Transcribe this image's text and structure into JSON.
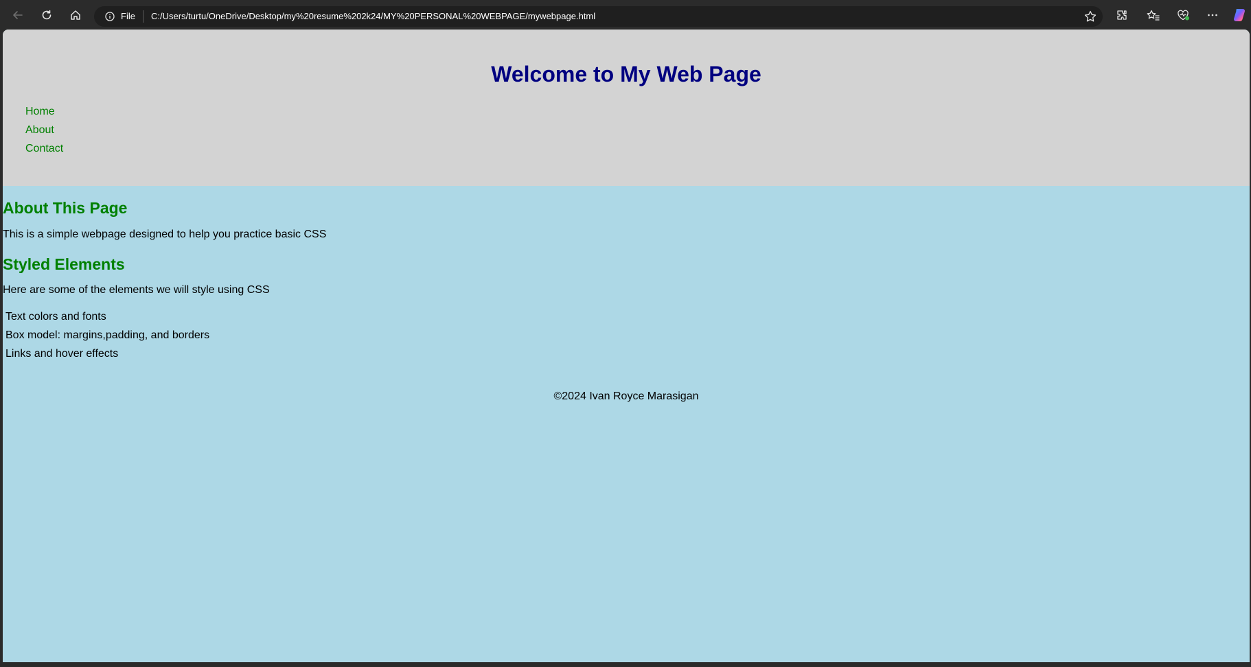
{
  "browser": {
    "address_scheme_label": "File",
    "url": "C:/Users/turtu/OneDrive/Desktop/my%20resume%202k24/MY%20PERSONAL%20WEBPAGE/mywebpage.html",
    "toolbar_icons": [
      "back-icon",
      "refresh-icon",
      "home-icon",
      "info-icon",
      "favorite-star-icon",
      "extensions-icon",
      "favorites-icon",
      "browser-essentials-icon",
      "more-menu-icon",
      "copilot-icon"
    ]
  },
  "page": {
    "header": {
      "title": "Welcome to My Web Page",
      "nav": [
        "Home",
        "About",
        "Contact"
      ]
    },
    "about": {
      "heading": "About This Page",
      "text": "This is a simple webpage designed to help you practice basic CSS"
    },
    "styled": {
      "heading": "Styled Elements",
      "text": "Here are some of the elements we will style using CSS",
      "items": [
        "Text colors and fonts",
        "Box model: margins,padding, and borders",
        "Links and hover effects"
      ]
    },
    "footer": "©2024 Ivan Royce Marasigan"
  },
  "colors": {
    "header_bg": "#d3d3d3",
    "body_bg": "#add8e6",
    "title": "#000080",
    "accent_green": "#008000",
    "browser_chrome": "#2b2b2b"
  }
}
